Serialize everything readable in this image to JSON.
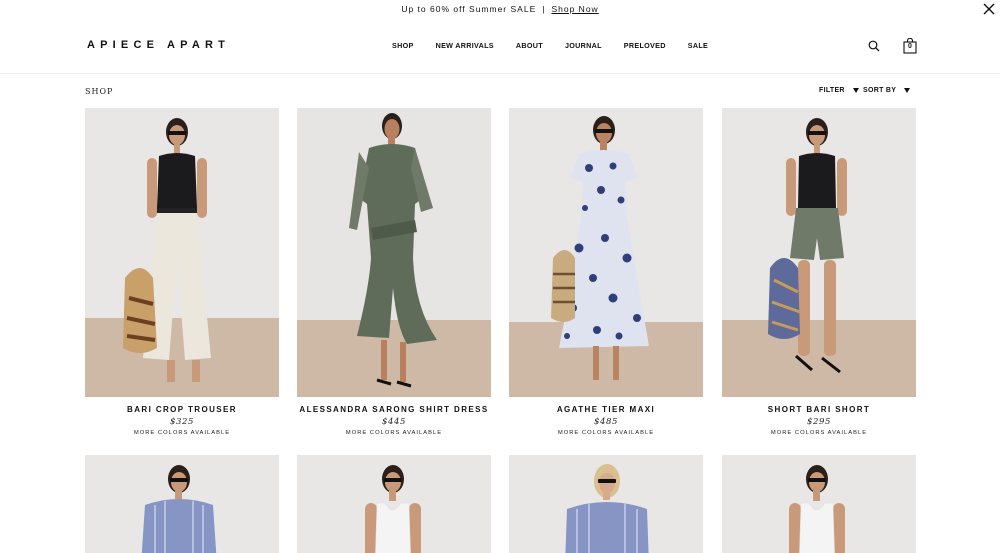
{
  "promo": {
    "text": "Up to 60% off Summer SALE",
    "separator": "|",
    "link": "Shop Now"
  },
  "header": {
    "logo": "APIECE APART",
    "nav": [
      "SHOP",
      "NEW ARRIVALS",
      "ABOUT",
      "JOURNAL",
      "PRELOVED",
      "SALE"
    ],
    "cart_count": "0"
  },
  "toolbar": {
    "section": "SHOP",
    "filter": "FILTER",
    "sort": "SORT BY"
  },
  "products": [
    {
      "name": "BARI CROP TROUSER",
      "price": "$325",
      "colors": "MORE COLORS AVAILABLE"
    },
    {
      "name": "ALESSANDRA SARONG SHIRT DRESS",
      "price": "$445",
      "colors": "MORE COLORS AVAILABLE"
    },
    {
      "name": "AGATHE TIER MAXI",
      "price": "$485",
      "colors": "MORE COLORS AVAILABLE"
    },
    {
      "name": "SHORT BARI SHORT",
      "price": "$295",
      "colors": "MORE COLORS AVAILABLE"
    }
  ],
  "colors": {
    "wall": "#e8e7e6",
    "floor": "#cdb9a5",
    "skin": "#c99a7a",
    "hair": "#2b1f1a",
    "black_top": "#1b1b1d",
    "cream": "#ece7dc",
    "sage": "#5f6c5a",
    "sage_light": "#6f7b68",
    "navy": "#2e3f7a",
    "blue_stripe": "#8795c4",
    "white_tank": "#f4f4f4"
  }
}
